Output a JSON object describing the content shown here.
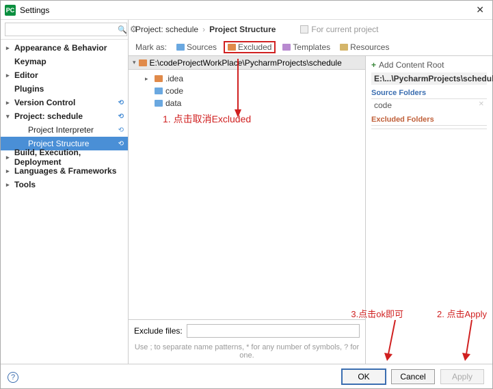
{
  "title": "Settings",
  "search_placeholder": "",
  "sidebar": {
    "items": [
      {
        "label": "Appearance & Behavior",
        "expandable": true,
        "bold": true
      },
      {
        "label": "Keymap",
        "bold": true
      },
      {
        "label": "Editor",
        "expandable": true,
        "bold": true
      },
      {
        "label": "Plugins",
        "bold": true
      },
      {
        "label": "Version Control",
        "expandable": true,
        "bold": true,
        "reset": true
      },
      {
        "label": "Project: schedule",
        "expandable": true,
        "expanded": true,
        "bold": true,
        "reset": true
      },
      {
        "label": "Project Interpreter",
        "sub": true,
        "reset": true
      },
      {
        "label": "Project Structure",
        "sub": true,
        "selected": true,
        "reset": true
      },
      {
        "label": "Build, Execution, Deployment",
        "expandable": true,
        "bold": true
      },
      {
        "label": "Languages & Frameworks",
        "expandable": true,
        "bold": true
      },
      {
        "label": "Tools",
        "expandable": true,
        "bold": true
      }
    ]
  },
  "breadcrumb": {
    "parent": "Project: schedule",
    "current": "Project Structure",
    "hint": "For current project"
  },
  "markas": {
    "label": "Mark as:",
    "sources": "Sources",
    "excluded": "Excluded",
    "templates": "Templates",
    "resources": "Resources"
  },
  "filetree": {
    "root": "E:\\codeProjectWorkPlace\\PycharmProjects\\schedule",
    "children": [
      {
        "label": ".idea",
        "expandable": true,
        "color": "orange"
      },
      {
        "label": "code",
        "color": "blue"
      },
      {
        "label": "data",
        "color": "blue"
      }
    ]
  },
  "exclude": {
    "label": "Exclude files:",
    "value": "",
    "hint": "Use ; to separate name patterns, * for any number of symbols, ? for one."
  },
  "rightpanel": {
    "add_root": "Add Content Root",
    "root_path": "E:\\...\\PycharmProjects\\schedule",
    "source_hdr": "Source Folders",
    "source_item": "code",
    "excluded_hdr": "Excluded Folders"
  },
  "footer": {
    "ok": "OK",
    "cancel": "Cancel",
    "apply": "Apply"
  },
  "annotations": {
    "a1": "1. 点击取消Excluded",
    "a2": "2. 点击Apply",
    "a3": "3.点击ok即可"
  }
}
